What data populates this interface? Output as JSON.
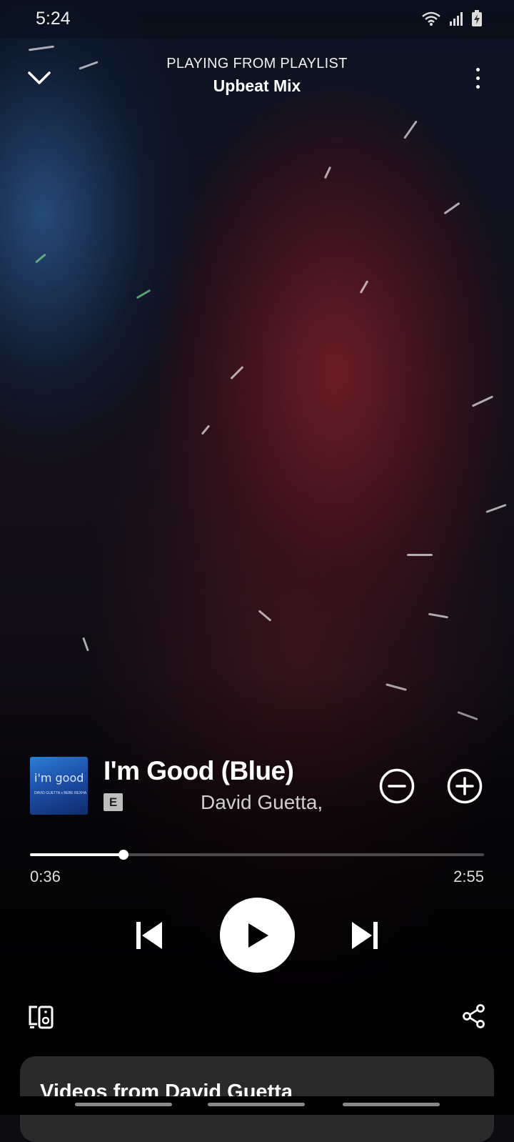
{
  "status_bar": {
    "time": "5:24",
    "icons": [
      "wifi-icon",
      "signal-icon",
      "battery-charging-icon"
    ]
  },
  "header": {
    "subtitle": "PLAYING FROM PLAYLIST",
    "title": "Upbeat Mix"
  },
  "track": {
    "title": "I'm Good (Blue)",
    "artist": "David Guetta,",
    "explicit_badge": "E",
    "album_art_text": "i'm good",
    "album_art_subtext": "DAVID GUETTA x BEBE REXHA"
  },
  "progress": {
    "elapsed": "0:36",
    "total": "2:55",
    "fraction": 0.206
  },
  "controls": {
    "play_state": "paused"
  },
  "videos_card": {
    "title": "Videos from David Guetta"
  },
  "colors": {
    "accent": "#ffffff",
    "card": "#2a2a2a",
    "explicit_badge": "#bdbdbd"
  }
}
